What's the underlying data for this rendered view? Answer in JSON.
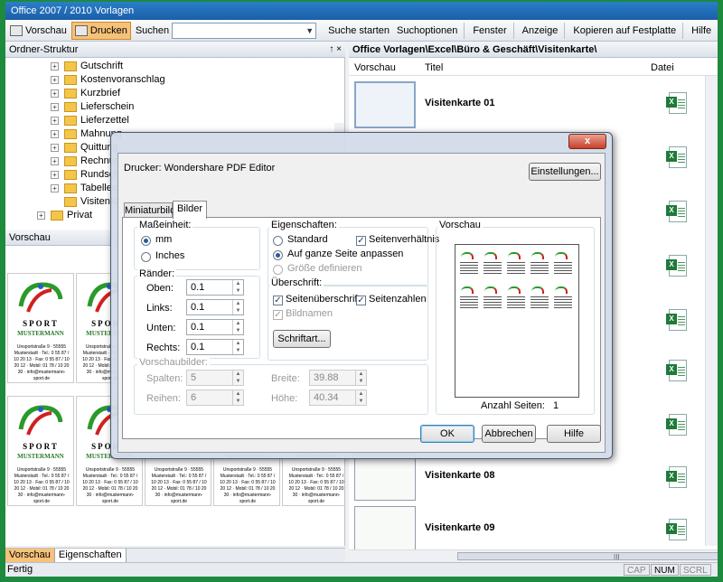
{
  "window": {
    "title": "Office 2007 / 2010 Vorlagen"
  },
  "toolbar": {
    "preview": "Vorschau",
    "print": "Drucken",
    "search_label": "Suchen",
    "search_value": "",
    "start_search": "Suche starten",
    "search_options": "Suchoptionen",
    "window": "Fenster",
    "view": "Anzeige",
    "copy": "Kopieren auf Festplatte",
    "help": "Hilfe"
  },
  "tree": {
    "header": "Ordner-Struktur",
    "header_controls": "↑ ×",
    "items": [
      {
        "label": "Gutschrift"
      },
      {
        "label": "Kostenvoranschlag"
      },
      {
        "label": "Kurzbrief"
      },
      {
        "label": "Lieferschein"
      },
      {
        "label": "Lieferzettel"
      },
      {
        "label": "Mahnung"
      },
      {
        "label": "Quittung"
      },
      {
        "label": "Rechnung"
      },
      {
        "label": "Rundschreiben"
      },
      {
        "label": "Tabellen"
      },
      {
        "label": "Visitenkarte"
      },
      {
        "label": "Privat"
      }
    ]
  },
  "preview_panel": {
    "header": "Vorschau",
    "header_controls": "↑ ×",
    "card_brand": "SPORT",
    "card_brand2": "MUSTERMANN",
    "card_address": "Unsportstraße 9 · 55555 Musterstadt · Tel.: 0 55 87 / 10 20 13 · Fax: 0 55 87 / 10 20 12 · Mobil: 01 78 / 10 20 30 · info@mustermann-sport.de"
  },
  "bottom_tabs": {
    "preview": "Vorschau",
    "properties": "Eigenschaften"
  },
  "status": {
    "text": "Fertig",
    "cap": "CAP",
    "num": "NUM",
    "scrl": "SCRL"
  },
  "right": {
    "path": "Office Vorlagen\\Excel\\Büro & Geschäft\\Visitenkarte\\",
    "col_preview": "Vorschau",
    "col_title": "Titel",
    "col_file": "Datei",
    "rows": [
      {
        "title": "Visitenkarte 01"
      },
      {
        "title": "Visitenkarte 08"
      },
      {
        "title": "Visitenkarte 09"
      }
    ],
    "scroll_grip": "III"
  },
  "dialog": {
    "close": "x",
    "printer": "Drucker: Wondershare PDF Editor",
    "settings": "Einstellungen...",
    "tabs": [
      "Miniaturbild",
      "Bilder"
    ],
    "unit_group": "Maßeinheit:",
    "unit_mm": "mm",
    "unit_inch": "Inches",
    "margins_group": "Ränder:",
    "margin_top": {
      "label": "Oben:",
      "value": "0.1"
    },
    "margin_left": {
      "label": "Links:",
      "value": "0.1"
    },
    "margin_bottom": {
      "label": "Unten:",
      "value": "0.1"
    },
    "margin_right": {
      "label": "Rechts:",
      "value": "0.1"
    },
    "props_group": "Eigenschaften:",
    "standard": "Standard",
    "aspect": "Seitenverhältnis",
    "fit": "Auf ganze Seite anpassen",
    "define": "Größe definieren",
    "heading_group": "Überschrift:",
    "page_heading": "Seitenüberschrift",
    "page_numbers": "Seitenzahlen",
    "image_names": "Bildnamen",
    "font_btn": "Schriftart...",
    "preview_images_group": "Vorschaubilder:",
    "columns": {
      "label": "Spalten:",
      "value": "5"
    },
    "rows": {
      "label": "Reihen:",
      "value": "6"
    },
    "width": {
      "label": "Breite:",
      "value": "39.88"
    },
    "height": {
      "label": "Höhe:",
      "value": "40.34"
    },
    "preview_group": "Vorschau",
    "pages_label": "Anzahl Seiten:",
    "pages_value": "1",
    "ok": "OK",
    "cancel": "Abbrechen",
    "help": "Hilfe",
    "checkmark": "✓"
  },
  "colors": {
    "accent": "#f6c27a",
    "excel": "#1f7a3a",
    "desktop": "#1d8a3e"
  }
}
